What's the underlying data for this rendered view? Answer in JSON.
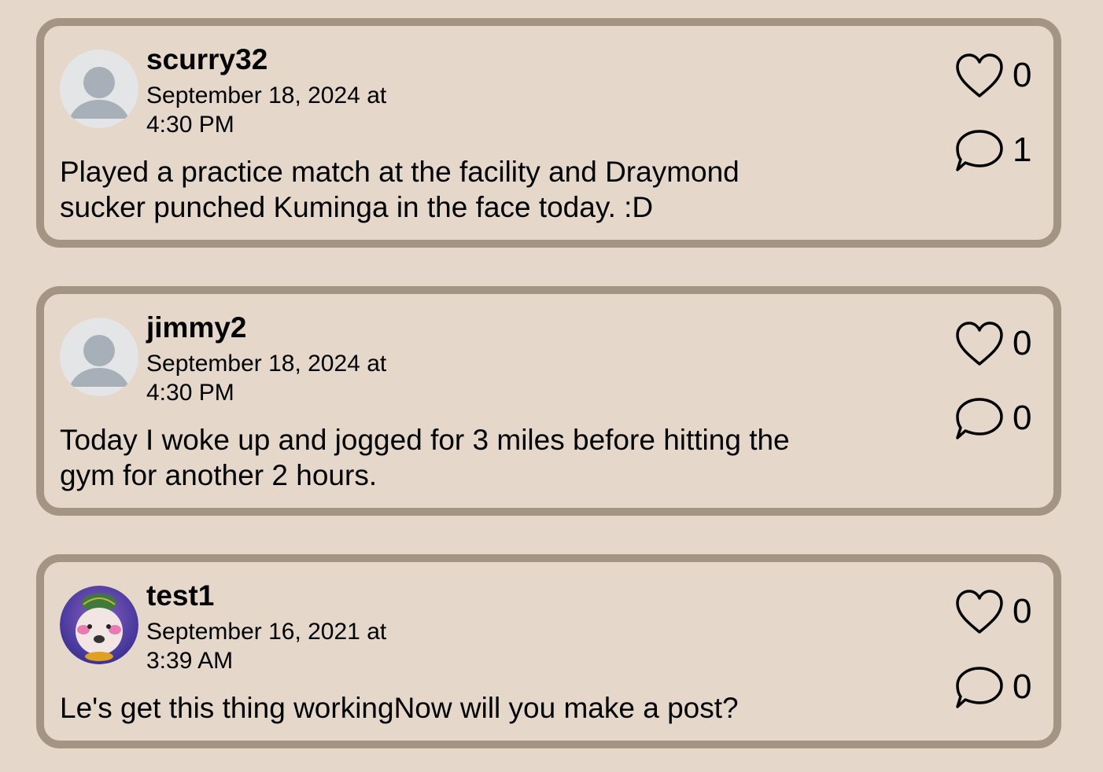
{
  "posts": [
    {
      "username": "scurry32",
      "timestamp": "September 18, 2024 at 4:30 PM",
      "text": "Played a practice match at the facility and Draymond sucker punched Kuminga in the face today. :D",
      "likes": "0",
      "comments": "1",
      "avatar": "default-avatar-icon"
    },
    {
      "username": "jimmy2",
      "timestamp": "September 18, 2024 at 4:30 PM",
      "text": "Today I woke up and jogged for 3 miles before hitting the gym for another 2 hours.",
      "likes": "0",
      "comments": "0",
      "avatar": "default-avatar-icon"
    },
    {
      "username": "test1",
      "timestamp": "September 16, 2021 at 3:39 AM",
      "text": "Le's get this thing workingNow will you make a post?",
      "likes": "0",
      "comments": "0",
      "avatar": "dog-photo-avatar"
    }
  ],
  "colors": {
    "background": "#e5d8cb",
    "card_border": "#a49483",
    "avatar_bg": "#e4e5e7",
    "avatar_figure": "#a7b0b8"
  }
}
